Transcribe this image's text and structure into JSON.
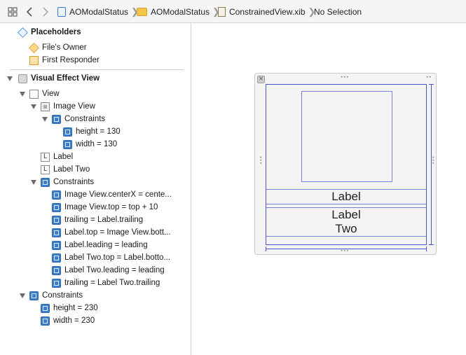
{
  "jumpbar": {
    "breadcrumbs": [
      "AOModalStatus",
      "AOModalStatus",
      "ConstrainedView.xib",
      "No Selection"
    ]
  },
  "outline": {
    "placeholders": {
      "title": "Placeholders",
      "items": [
        "File's Owner",
        "First Responder"
      ]
    },
    "visual_effect_view": {
      "title": "Visual Effect View",
      "view": {
        "title": "View",
        "image_view": {
          "title": "Image View",
          "constraints_title": "Constraints",
          "constraints": [
            "height = 130",
            "width = 130"
          ]
        },
        "label": "Label",
        "label_two": "Label Two",
        "constraints_title": "Constraints",
        "constraints": [
          "Image View.centerX = cente...",
          "Image View.top = top + 10",
          "trailing = Label.trailing",
          "Label.top = Image View.bott...",
          "Label.leading = leading",
          "Label Two.top = Label.botto...",
          "Label Two.leading = leading",
          "trailing = Label Two.trailing"
        ]
      },
      "constraints_title": "Constraints",
      "constraints": [
        "height = 230",
        "width = 230"
      ]
    }
  },
  "canvas": {
    "label": "Label",
    "label_two_line1": "Label",
    "label_two_line2": "Two"
  },
  "colors": {
    "selection_outline": "#4a54c9",
    "constraint_icon": "#3b7ccc"
  }
}
